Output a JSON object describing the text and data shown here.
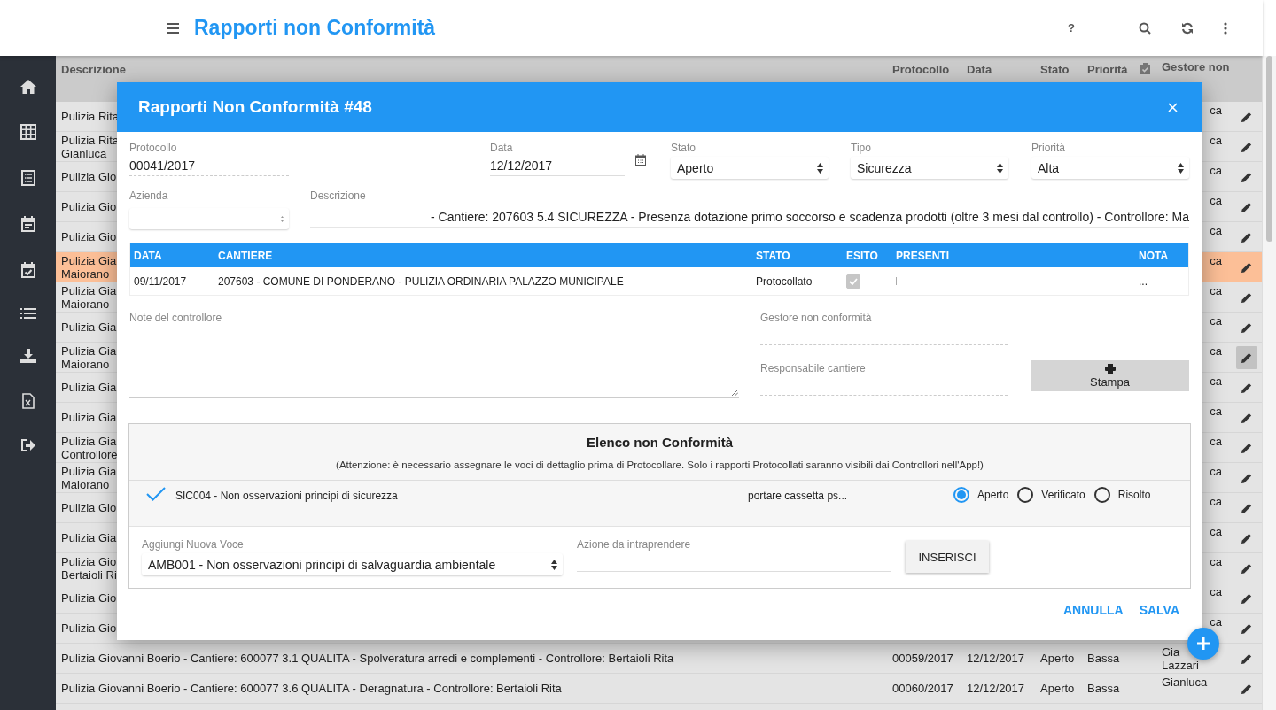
{
  "app_bar": {
    "title": "Rapporti non Conformità",
    "help": "?"
  },
  "table": {
    "columns": [
      "Descrizione",
      "Protocollo",
      "Data",
      "Stato",
      "Priorità",
      "Gestore non"
    ],
    "rows": [
      {
        "kind": "partial",
        "description": [
          "Pulizia Rita"
        ],
        "gestore": "ca",
        "highlighted": false,
        "hovered": false
      },
      {
        "kind": "partial",
        "description": [
          "Pulizia Rita",
          "Gianluca"
        ],
        "gestore": "ca",
        "highlighted": false,
        "hovered": false
      },
      {
        "kind": "partial",
        "description": [
          "Pulizia Gio"
        ],
        "gestore": "ca",
        "highlighted": false,
        "hovered": false
      },
      {
        "kind": "partial",
        "description": [
          "Pulizia Gio"
        ],
        "gestore": "ca",
        "highlighted": false,
        "hovered": false
      },
      {
        "kind": "partial",
        "description": [
          "Pulizia Gio"
        ],
        "gestore": "ca",
        "highlighted": false,
        "hovered": false
      },
      {
        "kind": "partial",
        "description": [
          "Pulizia Gia",
          "Maiorano"
        ],
        "gestore": "ca",
        "highlighted": true,
        "hovered": false
      },
      {
        "kind": "partial",
        "description": [
          "Pulizia Gia",
          "Maiorano"
        ],
        "gestore": "ca",
        "highlighted": false,
        "hovered": false
      },
      {
        "kind": "partial",
        "description": [
          "Pulizia Gia"
        ],
        "gestore": "ca",
        "highlighted": false,
        "hovered": false
      },
      {
        "kind": "partial",
        "description": [
          "Pulizia Gia",
          "Maiorano"
        ],
        "gestore": "ca",
        "highlighted": false,
        "hovered": true
      },
      {
        "kind": "partial",
        "description": [
          "Pulizia Gia"
        ],
        "gestore": "ca",
        "highlighted": false,
        "hovered": false
      },
      {
        "kind": "partial",
        "description": [
          "Pulizia Gia"
        ],
        "gestore": "ca",
        "highlighted": false,
        "hovered": false
      },
      {
        "kind": "partial",
        "description": [
          "Pulizia Gia",
          "Controllore"
        ],
        "gestore": "ca",
        "highlighted": false,
        "hovered": false
      },
      {
        "kind": "partial",
        "description": [
          "Pulizia Gia",
          "Maiorano"
        ],
        "gestore": "ca",
        "highlighted": false,
        "hovered": false
      },
      {
        "kind": "partial",
        "description": [
          "Pulizia Gio"
        ],
        "gestore": "ca",
        "highlighted": false,
        "hovered": false
      },
      {
        "kind": "partial",
        "description": [
          "Pulizia Gia"
        ],
        "gestore": "ca",
        "highlighted": false,
        "hovered": false
      },
      {
        "kind": "partial",
        "description": [
          "Pulizia Gio",
          "Bertaioli Ri"
        ],
        "gestore": "ca",
        "highlighted": false,
        "hovered": false
      },
      {
        "kind": "partial",
        "description": [
          "Pulizia Gio"
        ],
        "gestore": "ca",
        "highlighted": false,
        "hovered": false
      },
      {
        "kind": "partial",
        "description": [
          "Pulizia Gio"
        ],
        "gestore": "ca",
        "highlighted": false,
        "hovered": false
      },
      {
        "kind": "full",
        "description": [
          "Pulizia Giovanni Boerio - Cantiere: 600077 3.1 QUALITA - Spolveratura arredi e complementi - Controllore: Bertaioli Rita"
        ],
        "protocollo": "00059/2017",
        "data": "12/12/2017",
        "stato": "Aperto",
        "priorita": "Bassa",
        "gestore": "Gia\nLazzari",
        "highlighted": false,
        "hovered": false
      },
      {
        "kind": "full",
        "description": [
          "Pulizia Giovanni Boerio - Cantiere: 600077 3.6 QUALITA - Deragnatura - Controllore: Bertaioli Rita"
        ],
        "protocollo": "00060/2017",
        "data": "12/12/2017",
        "stato": "Aperto",
        "priorita": "Bassa",
        "gestore": "Gianluca",
        "highlighted": false,
        "hovered": false
      }
    ]
  },
  "dialog": {
    "title": "Rapporti Non Conformità #48",
    "protocollo": {
      "label": "Protocollo",
      "value": "00041/2017"
    },
    "data": {
      "label": "Data",
      "value": "12/12/2017"
    },
    "stato": {
      "label": "Stato",
      "value": "Aperto"
    },
    "tipo": {
      "label": "Tipo",
      "value": "Sicurezza"
    },
    "priorita": {
      "label": "Priorità",
      "value": "Alta"
    },
    "azienda": {
      "label": "Azienda"
    },
    "descrizione": {
      "label": "Descrizione",
      "value": "- Cantiere: 207603 5.4 SICUREZZA - Presenza dotazione primo soccorso e scadenza prodotti (oltre 3 mesi dal controllo) - Controllore: Ma"
    },
    "controls": {
      "columns": [
        "DATA",
        "CANTIERE",
        "STATO",
        "ESITO",
        "PRESENTI",
        "NOTA"
      ],
      "rows": [
        {
          "data": "09/11/2017",
          "cantiere": "207603 - COMUNE DI PONDERANO - PULIZIA ORDINARIA PALAZZO MUNICIPALE",
          "stato": "Protocollato",
          "esito": true,
          "nota": "..."
        }
      ]
    },
    "note": {
      "label": "Note del controllore"
    },
    "gestore": {
      "label": "Gestore non conformità"
    },
    "responsabile": {
      "label": "Responsabile cantiere"
    },
    "print_button": "Stampa",
    "nc_list": {
      "title": "Elenco non Conformità",
      "notice": "(Attenzione: è necessario assegnare le voci di dettaglio prima di Protocollare. Solo i rapporti Protocollati saranno visibili dai Controllori nell'App!)",
      "items": [
        {
          "code": "SIC004 - Non osservazioni principi di sicurezza",
          "action": "portare cassetta ps...",
          "options": [
            {
              "label": "Aperto",
              "selected": true
            },
            {
              "label": "Verificato",
              "selected": false
            },
            {
              "label": "Risolto",
              "selected": false
            }
          ]
        }
      ],
      "new_item": {
        "label": "Aggiungi Nuova Voce",
        "value": "AMB001 - Non osservazioni principi di salvaguardia ambientale"
      },
      "action": {
        "label": "Azione da intraprendere"
      },
      "insert_button": "INSERISCI"
    },
    "buttons": [
      "ANNULLA",
      "SALVA"
    ]
  }
}
